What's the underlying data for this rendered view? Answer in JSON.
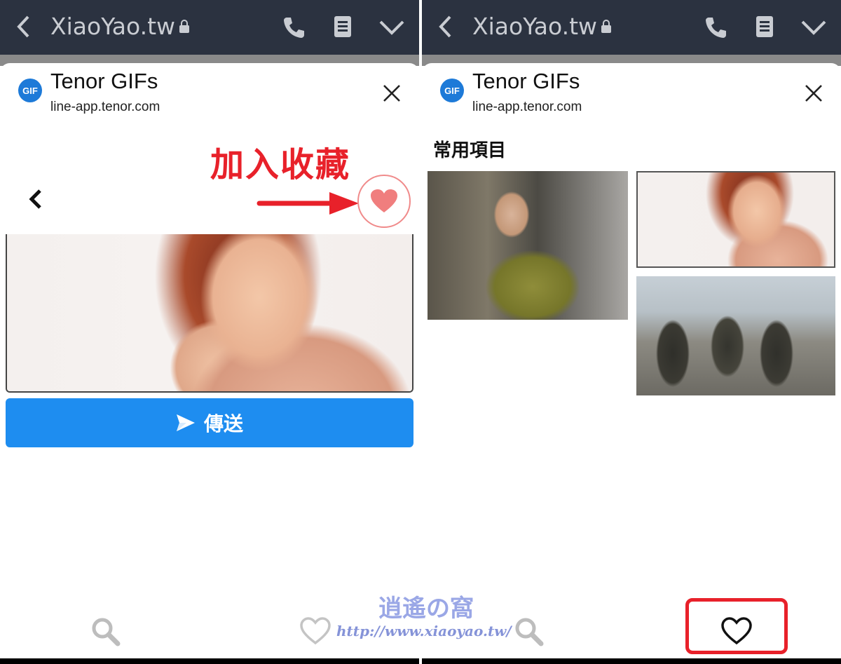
{
  "left_panel": {
    "topbar": {
      "title": "XiaoYao.tw"
    },
    "sheet": {
      "logo_text": "GIF",
      "title": "Tenor GIFs",
      "url": "line-app.tenor.com"
    },
    "annotation": "加入收藏",
    "send_button_label": "傳送"
  },
  "right_panel": {
    "topbar": {
      "title": "XiaoYao.tw"
    },
    "sheet": {
      "logo_text": "GIF",
      "title": "Tenor GIFs",
      "url": "line-app.tenor.com"
    },
    "section_title": "常用項目"
  },
  "watermark": {
    "title": "逍遙の窩",
    "url": "http://www.xiaoyao.tw/"
  },
  "colors": {
    "topbar_bg": "#2b3240",
    "send_button": "#1e8df0",
    "annotation_red": "#e8212a",
    "favorite_heart": "#f07e7e",
    "tenor_blue": "#1d7ad8"
  },
  "icons": [
    "back-icon",
    "lock-icon",
    "phone-icon",
    "notes-icon",
    "chevron-down-icon",
    "close-icon",
    "heart-icon",
    "send-icon",
    "search-icon"
  ]
}
